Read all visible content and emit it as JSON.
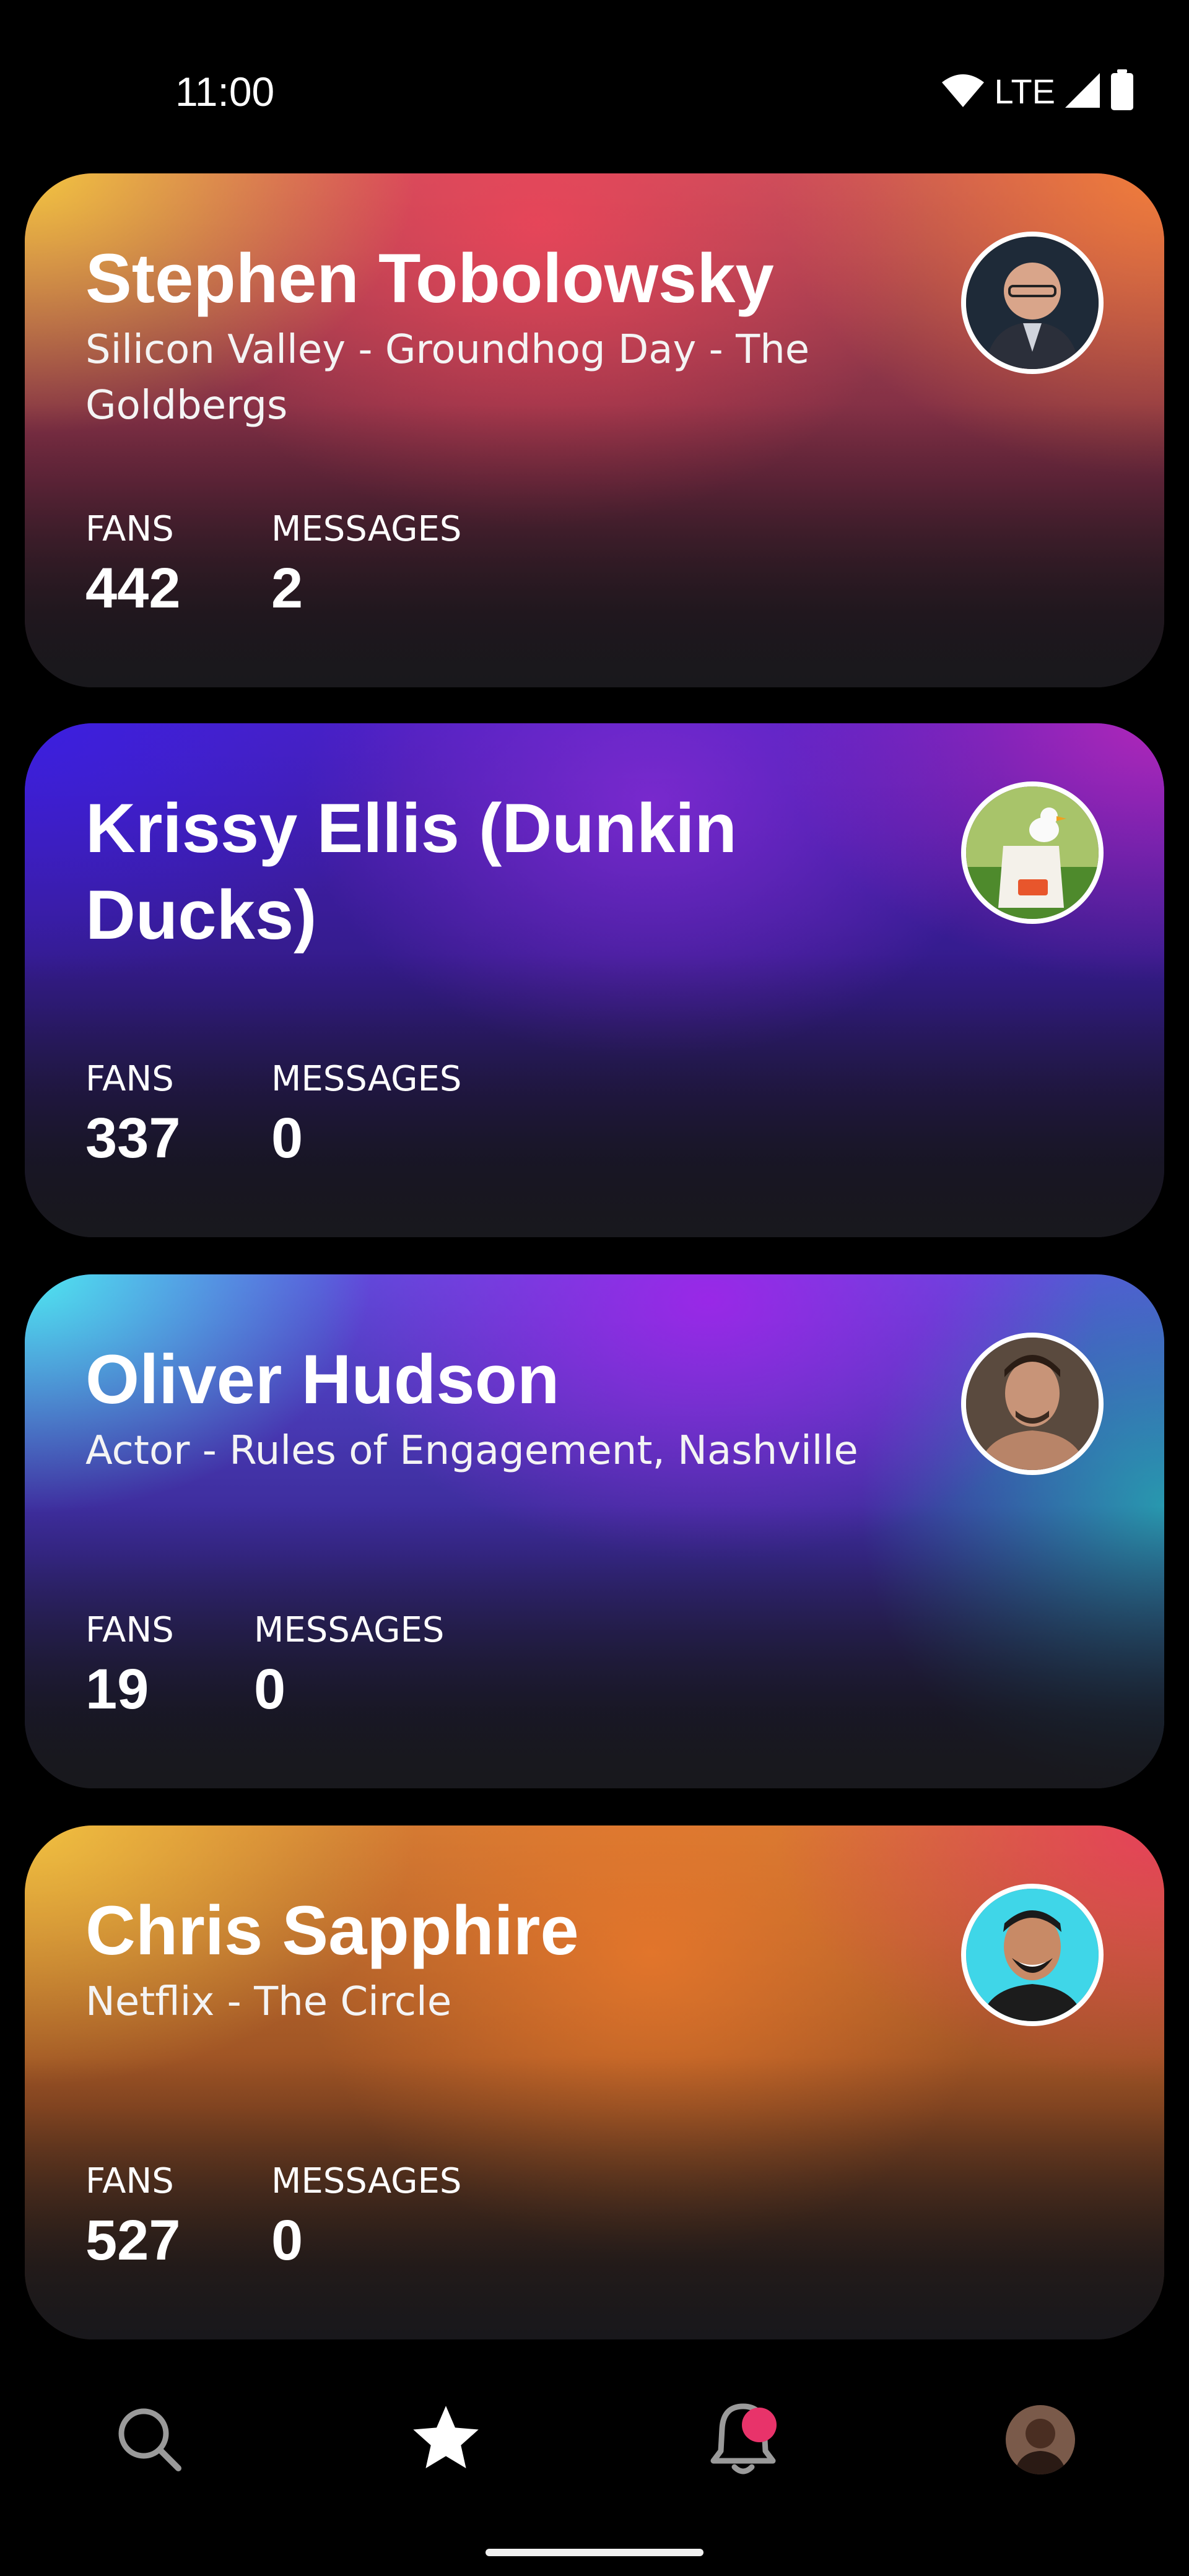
{
  "status_bar": {
    "time": "11:00",
    "network": "LTE",
    "icons": [
      "wifi-icon",
      "signal-icon",
      "battery-icon"
    ]
  },
  "cards": [
    {
      "name": "Stephen Tobolowsky",
      "subtitle": "Silicon Valley - Groundhog Day - The Goldbergs",
      "fans_label": "FANS",
      "fans": "442",
      "messages_label": "MESSAGES",
      "messages": "2"
    },
    {
      "name": "Krissy Ellis (Dunkin Ducks)",
      "subtitle": "",
      "fans_label": "FANS",
      "fans": "337",
      "messages_label": "MESSAGES",
      "messages": "0"
    },
    {
      "name": "Oliver Hudson",
      "subtitle": "Actor - Rules of Engagement, Nashville",
      "fans_label": "FANS",
      "fans": "19",
      "messages_label": "MESSAGES",
      "messages": "0"
    },
    {
      "name": "Chris Sapphire",
      "subtitle": "Netflix - The Circle",
      "fans_label": "FANS",
      "fans": "527",
      "messages_label": "MESSAGES",
      "messages": "0"
    }
  ],
  "bottom_nav": {
    "items": [
      "search-icon",
      "star-icon",
      "bell-icon",
      "profile-avatar"
    ],
    "active": "star-icon",
    "notification_badge": true
  },
  "colors": {
    "background": "#000000",
    "notification_badge": "#e8336a",
    "text": "#ffffff"
  }
}
